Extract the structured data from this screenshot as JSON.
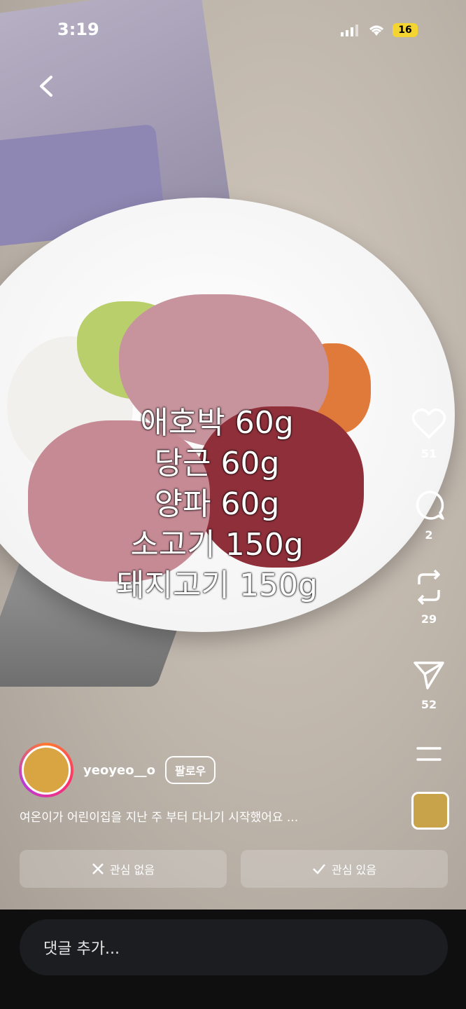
{
  "status_bar": {
    "time": "3:19",
    "battery_text": "16"
  },
  "overlay_text": {
    "lines": [
      "애호박 60g",
      "당근 60g",
      "양파 60g",
      "소고기 150g",
      "돼지고기 150g"
    ]
  },
  "side_actions": {
    "like_count": "51",
    "comment_count": "2",
    "repost_count": "29",
    "share_count": "52"
  },
  "author": {
    "username": "yeoyeo__o",
    "follow_label": "팔로우"
  },
  "caption": "여온이가 어린이집을 지난 주 부터 다니기 시작했어요 ...",
  "actions": {
    "not_interested": "관심 없음",
    "interested": "관심 있음"
  },
  "comment": {
    "placeholder": "댓글 추가..."
  },
  "colors": {
    "comment_bar": "#0f0f10",
    "comment_field": "#1c1d21",
    "battery": "#f3d430"
  }
}
